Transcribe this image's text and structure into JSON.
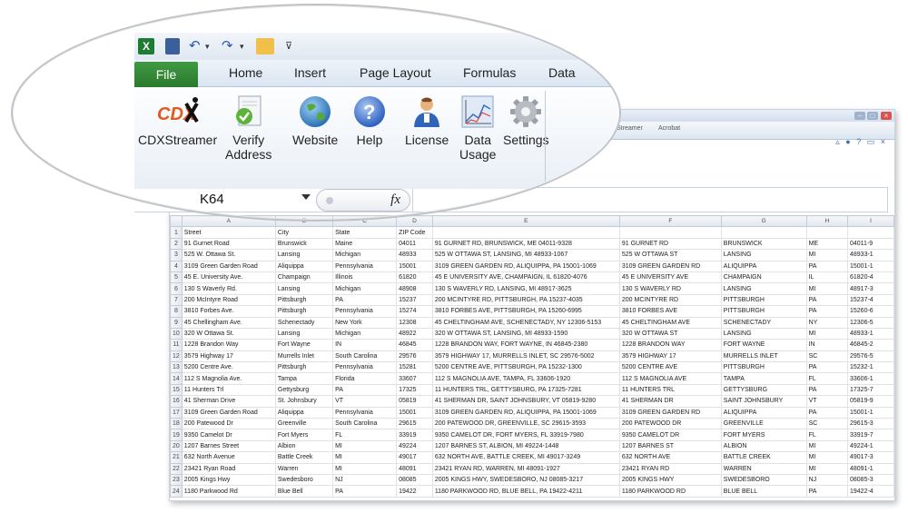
{
  "ribbon": {
    "file_tab": "File",
    "tabs": [
      "Home",
      "Insert",
      "Page Layout",
      "Formulas",
      "Data"
    ],
    "buttons": {
      "cdxstreamer": "CDXStreamer",
      "cdx_logo": "CDX",
      "verify_line1": "Verify",
      "verify_line2": "Address",
      "website": "Website",
      "help": "Help",
      "license": "License",
      "data_usage_line1": "Data",
      "data_usage_line2": "Usage",
      "settings": "Settings"
    },
    "icons": [
      "excel-icon",
      "save-icon",
      "undo-icon",
      "redo-icon",
      "open-folder-icon",
      "customize-qat-icon"
    ]
  },
  "formula_bar": {
    "name_box": "K64",
    "fx": "fx",
    "formula": ""
  },
  "background_window": {
    "tabs": [
      "Streamer",
      "Acrobat"
    ]
  },
  "sheet": {
    "column_headers": [
      "A",
      "B",
      "C",
      "D",
      "E",
      "F",
      "G",
      "H",
      "I"
    ],
    "rows": [
      [
        "Street",
        "City",
        "State",
        "ZIP Code",
        "",
        "",
        "",
        "",
        ""
      ],
      [
        "91 Gurnet Road",
        "Brunswick",
        "Maine",
        "04011",
        "91 GURNET RD, BRUNSWICK, ME 04011-9328",
        "91 GURNET RD",
        "BRUNSWICK",
        "ME",
        "04011-9"
      ],
      [
        "525 W. Ottawa St.",
        "Lansing",
        "Michigan",
        "48933",
        "525 W OTTAWA ST, LANSING, MI 48933-1067",
        "525 W OTTAWA ST",
        "LANSING",
        "MI",
        "48933-1"
      ],
      [
        "3109 Green Garden Road",
        "Aliquippa",
        "Pennsylvania",
        "15001",
        "3109 GREEN GARDEN RD, ALIQUIPPA, PA 15001-1069",
        "3109 GREEN GARDEN RD",
        "ALIQUIPPA",
        "PA",
        "15001-1"
      ],
      [
        "45 E. University Ave.",
        "Champaign",
        "Illinois",
        "61820",
        "45 E UNIVERSITY AVE, CHAMPAIGN, IL 61820-4076",
        "45 E UNIVERSITY AVE",
        "CHAMPAIGN",
        "IL",
        "61820-4"
      ],
      [
        "130 S Waverly Rd.",
        "Lansing",
        "Michigan",
        "48908",
        "130 S WAVERLY RD, LANSING, MI 48917-3625",
        "130 S WAVERLY RD",
        "LANSING",
        "MI",
        "48917-3"
      ],
      [
        "200 McIntyre Road",
        "Pittsburgh",
        "PA",
        "15237",
        "200 MCINTYRE RD, PITTSBURGH, PA 15237-4035",
        "200 MCINTYRE RD",
        "PITTSBURGH",
        "PA",
        "15237-4"
      ],
      [
        "3810 Forbes Ave.",
        "Pittsburgh",
        "Pennsylvania",
        "15274",
        "3810 FORBES AVE, PITTSBURGH, PA 15260-6995",
        "3810 FORBES AVE",
        "PITTSBURGH",
        "PA",
        "15260-6"
      ],
      [
        "45 Chellingham Ave.",
        "Schenectady",
        "New York",
        "12308",
        "45 CHELTINGHAM AVE, SCHENECTADY, NY 12306-5153",
        "45 CHELTINGHAM AVE",
        "SCHENECTADY",
        "NY",
        "12306-5"
      ],
      [
        "320 W Ottawa St.",
        "Lansing",
        "Michigan",
        "48922",
        "320 W OTTAWA ST, LANSING, MI 48933-1590",
        "320 W OTTAWA ST",
        "LANSING",
        "MI",
        "48933-1"
      ],
      [
        "1228 Brandon Way",
        "Fort Wayne",
        "IN",
        "46845",
        "1228 BRANDON WAY, FORT WAYNE, IN 46845-2380",
        "1228 BRANDON WAY",
        "FORT WAYNE",
        "IN",
        "46845-2"
      ],
      [
        "3579 Highway 17",
        "Murrells Inlet",
        "South Carolina",
        "29576",
        "3579 HIGHWAY 17, MURRELLS INLET, SC 29576-5002",
        "3579 HIGHWAY 17",
        "MURRELLS INLET",
        "SC",
        "29576-5"
      ],
      [
        "5200 Centre Ave.",
        "Pittsburgh",
        "Pennsylvania",
        "15281",
        "5200 CENTRE AVE, PITTSBURGH, PA 15232-1300",
        "5200 CENTRE AVE",
        "PITTSBURGH",
        "PA",
        "15232-1"
      ],
      [
        "112 S Magnolia Ave.",
        "Tampa",
        "Florida",
        "33607",
        "112 S MAGNOLIA AVE, TAMPA, FL 33606-1920",
        "112 S MAGNOLIA AVE",
        "TAMPA",
        "FL",
        "33606-1"
      ],
      [
        "11 Hunters Trl",
        "Gettysburg",
        "PA",
        "17325",
        "11 HUNTERS TRL, GETTYSBURG, PA 17325-7281",
        "11 HUNTERS TRL",
        "GETTYSBURG",
        "PA",
        "17325-7"
      ],
      [
        "41 Sherman Drive",
        "St. Johnsbury",
        "VT",
        "05819",
        "41 SHERMAN DR, SAINT JOHNSBURY, VT 05819-9280",
        "41 SHERMAN DR",
        "SAINT JOHNSBURY",
        "VT",
        "05819-9"
      ],
      [
        "3109 Green Garden Road",
        "Aliquippa",
        "Pennsylvania",
        "15001",
        "3109 GREEN GARDEN RD, ALIQUIPPA, PA 15001-1069",
        "3109 GREEN GARDEN RD",
        "ALIQUIPPA",
        "PA",
        "15001-1"
      ],
      [
        "200 Patewood Dr",
        "Greenville",
        "South Carolina",
        "29615",
        "200 PATEWOOD DR, GREENVILLE, SC 29615-3593",
        "200 PATEWOOD DR",
        "GREENVILLE",
        "SC",
        "29615-3"
      ],
      [
        "9350 Camelot Dr",
        "Fort Myers",
        "FL",
        "33919",
        "9350 CAMELOT DR, FORT MYERS, FL 33919-7980",
        "9350 CAMELOT DR",
        "FORT MYERS",
        "FL",
        "33919-7"
      ],
      [
        "1207 Barnes Street",
        "Albion",
        "MI",
        "49224",
        "1207 BARNES ST, ALBION, MI 49224-1448",
        "1207 BARNES ST",
        "ALBION",
        "MI",
        "49224-1"
      ],
      [
        "632 North Avenue",
        "Battle Creek",
        "MI",
        "49017",
        "632 NORTH AVE, BATTLE CREEK, MI 49017-3249",
        "632 NORTH AVE",
        "BATTLE CREEK",
        "MI",
        "49017-3"
      ],
      [
        "23421 Ryan Road",
        "Warren",
        "MI",
        "48091",
        "23421 RYAN RD, WARREN, MI 48091-1927",
        "23421 RYAN RD",
        "WARREN",
        "MI",
        "48091-1"
      ],
      [
        "2005 Kings Hwy",
        "Swedesboro",
        "NJ",
        "08085",
        "2005 KINGS HWY, SWEDESBORO, NJ 08085-3217",
        "2005 KINGS HWY",
        "SWEDESBORO",
        "NJ",
        "08085-3"
      ],
      [
        "1180 Parkwood Rd",
        "Blue Bell",
        "PA",
        "19422",
        "1180 PARKWOOD RD, BLUE BELL, PA 19422-4211",
        "1180 PARKWOOD RD",
        "BLUE BELL",
        "PA",
        "19422-4"
      ]
    ]
  },
  "colors": {
    "file_tab": "#2f8a33",
    "ribbon_bg": "#e9eff6",
    "grid_line": "#dfe3e8"
  }
}
